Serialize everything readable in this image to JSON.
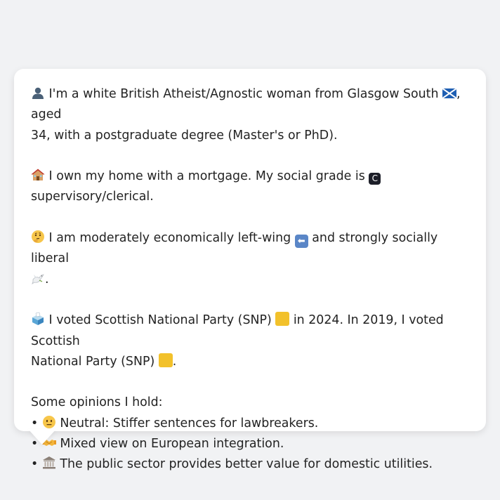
{
  "profile": {
    "identity": {
      "text_before_flag": "I'm a white British Atheist/Agnostic woman from Glasgow South",
      "text_after_flag": ", aged",
      "line2": "34, with a postgraduate degree (Master's or PhD).",
      "icon": "person-silhouette-icon",
      "flag_icon": "scotland-flag-icon"
    },
    "home": {
      "text_line1": "I own my home with a mortgage. My social grade is",
      "grade_badge": "C",
      "line2": "supervisory/clerical.",
      "icon": "house-icon"
    },
    "politics": {
      "text_before_arrow": "I am moderately economically left-wing",
      "text_after_arrow": "and strongly socially liberal",
      "line2_suffix": ".",
      "icon": "thinking-face-icon",
      "arrow_icon": "left-arrow-icon",
      "dove_icon": "dove-icon"
    },
    "voting": {
      "text_before_sq1": "I voted Scottish National Party (SNP)",
      "text_after_sq1": "in 2024. In 2019, I voted Scottish",
      "line2_before_sq": "National Party (SNP)",
      "line2_suffix": ".",
      "icon": "ballot-box-icon",
      "party_color": "#f2c12b"
    },
    "opinions": {
      "heading": "Some opinions I hold:",
      "bullet": "•",
      "items": [
        {
          "icon": "neutral-face-icon",
          "text": "Neutral: Stiffer sentences for lawbreakers."
        },
        {
          "icon": "handshake-icon",
          "text": "Mixed view on European integration."
        },
        {
          "icon": "classical-building-icon",
          "text": "The public sector provides better value for domestic utilities."
        }
      ]
    }
  }
}
